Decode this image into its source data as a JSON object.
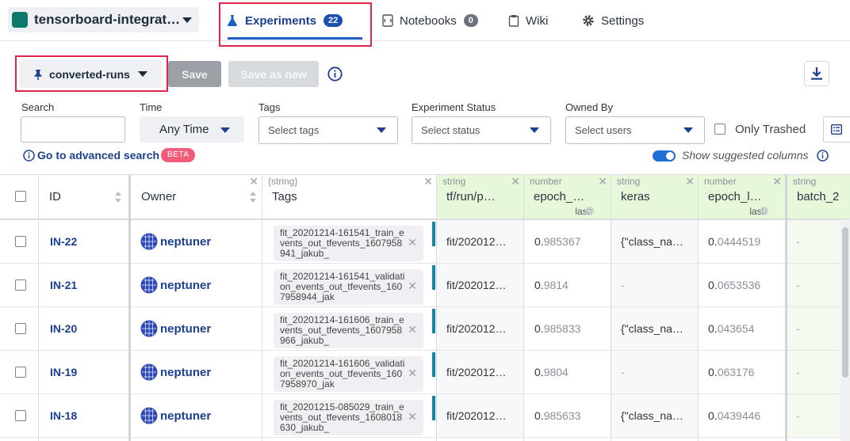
{
  "project": {
    "name": "tensorboard-integrat…",
    "color": "#0e7a6b"
  },
  "nav": {
    "experiments": {
      "label": "Experiments",
      "count": "22"
    },
    "notebooks": {
      "label": "Notebooks",
      "count": "0"
    },
    "wiki": {
      "label": "Wiki"
    },
    "settings": {
      "label": "Settings"
    }
  },
  "toolbar": {
    "view": "converted-runs",
    "save": "Save",
    "save_as_new": "Save as new"
  },
  "filters": {
    "search_label": "Search",
    "time_label": "Time",
    "time_value": "Any Time",
    "tags_label": "Tags",
    "tags_placeholder": "Select tags",
    "status_label": "Experiment Status",
    "status_placeholder": "Select status",
    "owned_label": "Owned By",
    "owned_placeholder": "Select users",
    "only_trashed": "Only Trashed",
    "advanced_search": "Go to advanced search",
    "beta": "BETA",
    "suggested_columns": "Show suggested columns"
  },
  "columns": {
    "id": "ID",
    "owner": "Owner",
    "tags_type": "{string}",
    "tags": "Tags",
    "c1_type": "string",
    "c1": "tf/run/p…",
    "c2_type": "number",
    "c2": "epoch_…",
    "c2_sub": "last",
    "c3_type": "string",
    "c3": "keras",
    "c4_type": "number",
    "c4": "epoch_l…",
    "c4_sub": "last",
    "c5_type": "string",
    "c5": "batch_2"
  },
  "rows": [
    {
      "id": "IN-22",
      "owner": "neptuner",
      "tag": "fit_20201214-161541_train_events_out_tfevents_1607958941_jakub_",
      "path": "fit/202012…",
      "acc_int": "0.",
      "acc_dec": "985367",
      "keras": "{\"class_na…",
      "loss_int": "0.",
      "loss_dec": "0444519",
      "batch": "-"
    },
    {
      "id": "IN-21",
      "owner": "neptuner",
      "tag": "fit_20201214-161541_validation_events_out_tfevents_1607958944_jak",
      "path": "fit/202012…",
      "acc_int": "0.",
      "acc_dec": "9814",
      "keras": "-",
      "loss_int": "0.",
      "loss_dec": "0653536",
      "batch": "-"
    },
    {
      "id": "IN-20",
      "owner": "neptuner",
      "tag": "fit_20201214-161606_train_events_out_tfevents_1607958966_jakub_",
      "path": "fit/202012…",
      "acc_int": "0.",
      "acc_dec": "985833",
      "keras": "{\"class_na…",
      "loss_int": "0.",
      "loss_dec": "043654",
      "batch": "-"
    },
    {
      "id": "IN-19",
      "owner": "neptuner",
      "tag": "fit_20201214-161606_validation_events_out_tfevents_1607958970_jak",
      "path": "fit/202012…",
      "acc_int": "0.",
      "acc_dec": "9804",
      "keras": "-",
      "loss_int": "0.",
      "loss_dec": "063176",
      "batch": "-"
    },
    {
      "id": "IN-18",
      "owner": "neptuner",
      "tag": "fit_20201215-085029_train_events_out_tfevents_1608018630_jakub_",
      "path": "fit/202012…",
      "acc_int": "0.",
      "acc_dec": "985633",
      "keras": "{\"class_na…",
      "loss_int": "0.",
      "loss_dec": "0439446",
      "batch": "-"
    }
  ]
}
